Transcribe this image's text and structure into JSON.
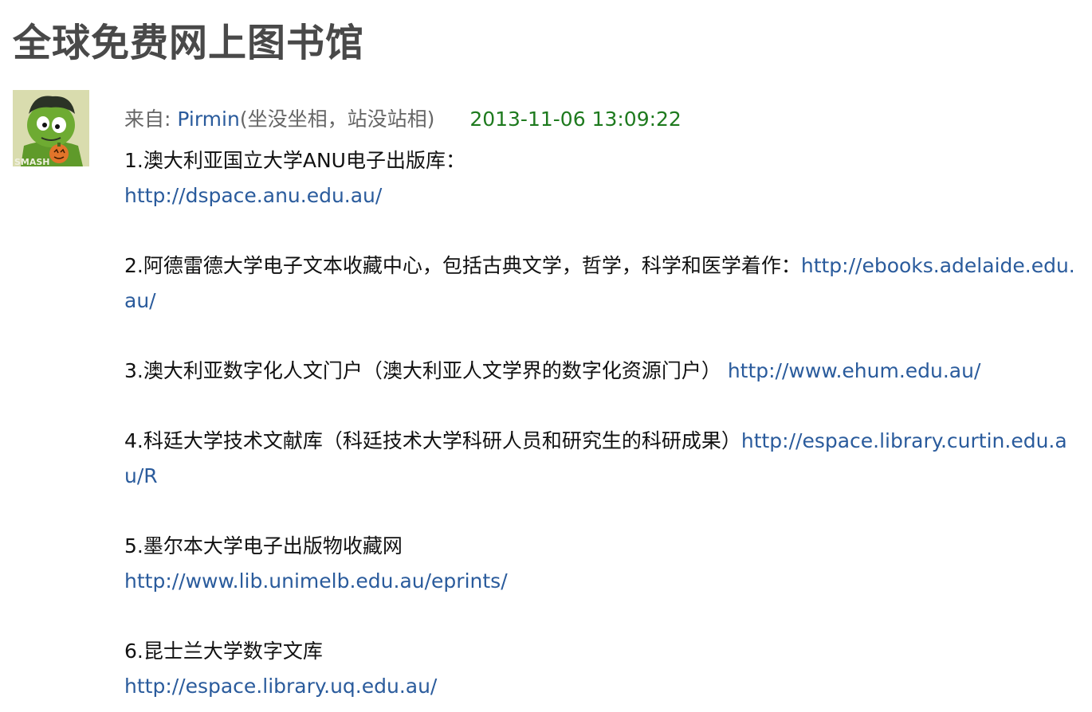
{
  "page": {
    "title": "全球免费网上图书馆"
  },
  "post": {
    "from_label": "来自: ",
    "author_name": "Pirmin",
    "author_sig": "(坐没坐相，站没站相)",
    "timestamp": "2013-11-06 13:09:22",
    "items": [
      {
        "desc": "1.澳大利亚国立大学ANU电子出版库：",
        "url": "http://dspace.anu.edu.au/"
      },
      {
        "desc": "2.阿德雷德大学电子文本收藏中心，包括古典文学，哲学，科学和医学着作：",
        "url": "http://ebooks.adelaide.edu.au/"
      },
      {
        "desc": "3.澳大利亚数字化人文门户（澳大利亚人文学界的数字化资源门户） ",
        "url": "http://www.ehum.edu.au/"
      },
      {
        "desc": "4.科廷大学技术文献库（科廷技术大学科研人员和研究生的科研成果）",
        "url": "http://espace.library.curtin.edu.au/R"
      },
      {
        "desc": "5.墨尔本大学电子出版物收藏网",
        "url": "http://www.lib.unimelb.edu.au/eprints/"
      },
      {
        "desc": "6.昆士兰大学数字文库",
        "url": "http://espace.library.uq.edu.au/"
      }
    ]
  },
  "avatar": {
    "badge_text": "SMASH",
    "icon": "hulk-cartoon-avatar-icon"
  },
  "colors": {
    "link": "#2a5b9c",
    "timestamp": "#1e7a1e",
    "title": "#494949",
    "meta": "#666666"
  }
}
